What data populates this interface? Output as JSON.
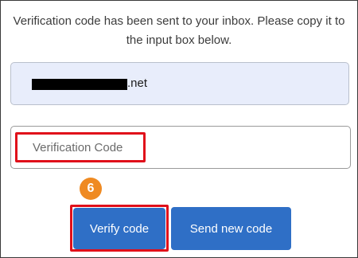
{
  "message": "Verification code has been sent to your inbox. Please copy it to the input box below.",
  "email_field": {
    "suffix": ".net",
    "redacted": true
  },
  "code_field": {
    "placeholder": "Verification Code",
    "value": ""
  },
  "step_badge": "6",
  "buttons": {
    "verify_label": "Verify code",
    "send_new_label": "Send new code"
  },
  "colors": {
    "primary_button": "#2f6fc6",
    "highlight": "#e0101a",
    "badge": "#ef8a22",
    "email_field_bg": "#e8edfb"
  }
}
